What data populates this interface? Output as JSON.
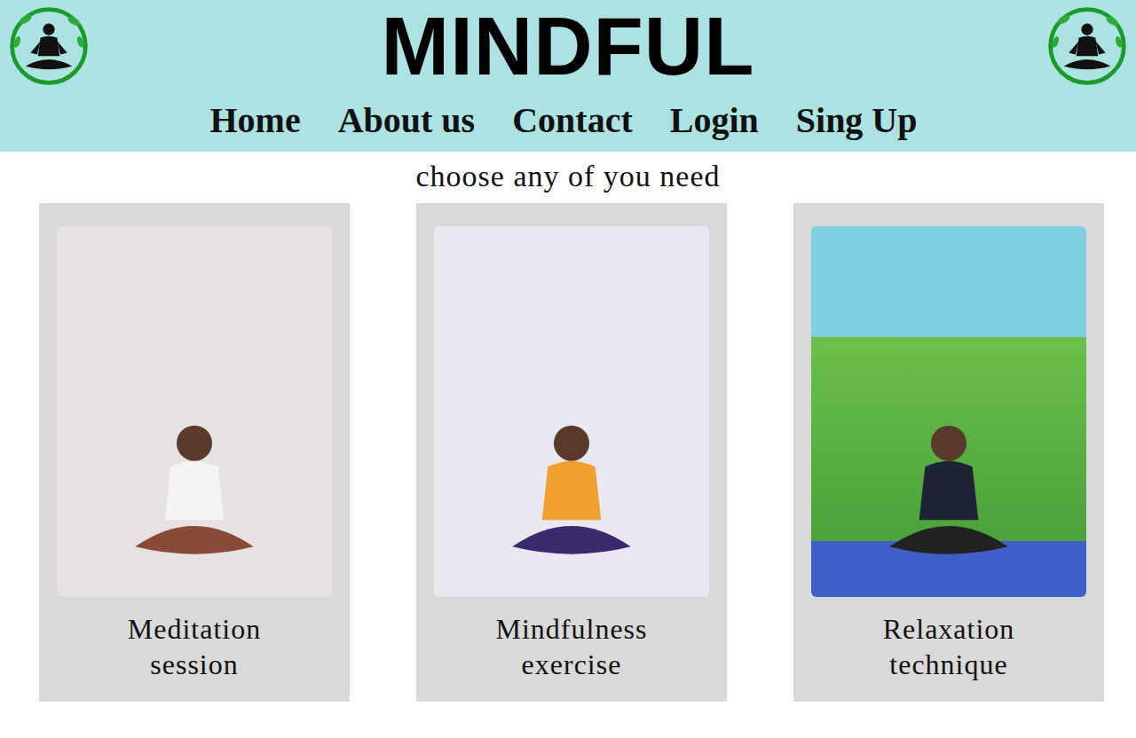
{
  "header": {
    "title": "MINDFUL"
  },
  "nav": [
    {
      "label": "Home"
    },
    {
      "label": "About us"
    },
    {
      "label": "Contact"
    },
    {
      "label": "Login"
    },
    {
      "label": "Sing Up"
    }
  ],
  "subtitle": "choose any of you need",
  "cards": [
    {
      "caption": "Meditation session"
    },
    {
      "caption": "Mindfulness exercise"
    },
    {
      "caption": "Relaxation technique"
    }
  ]
}
